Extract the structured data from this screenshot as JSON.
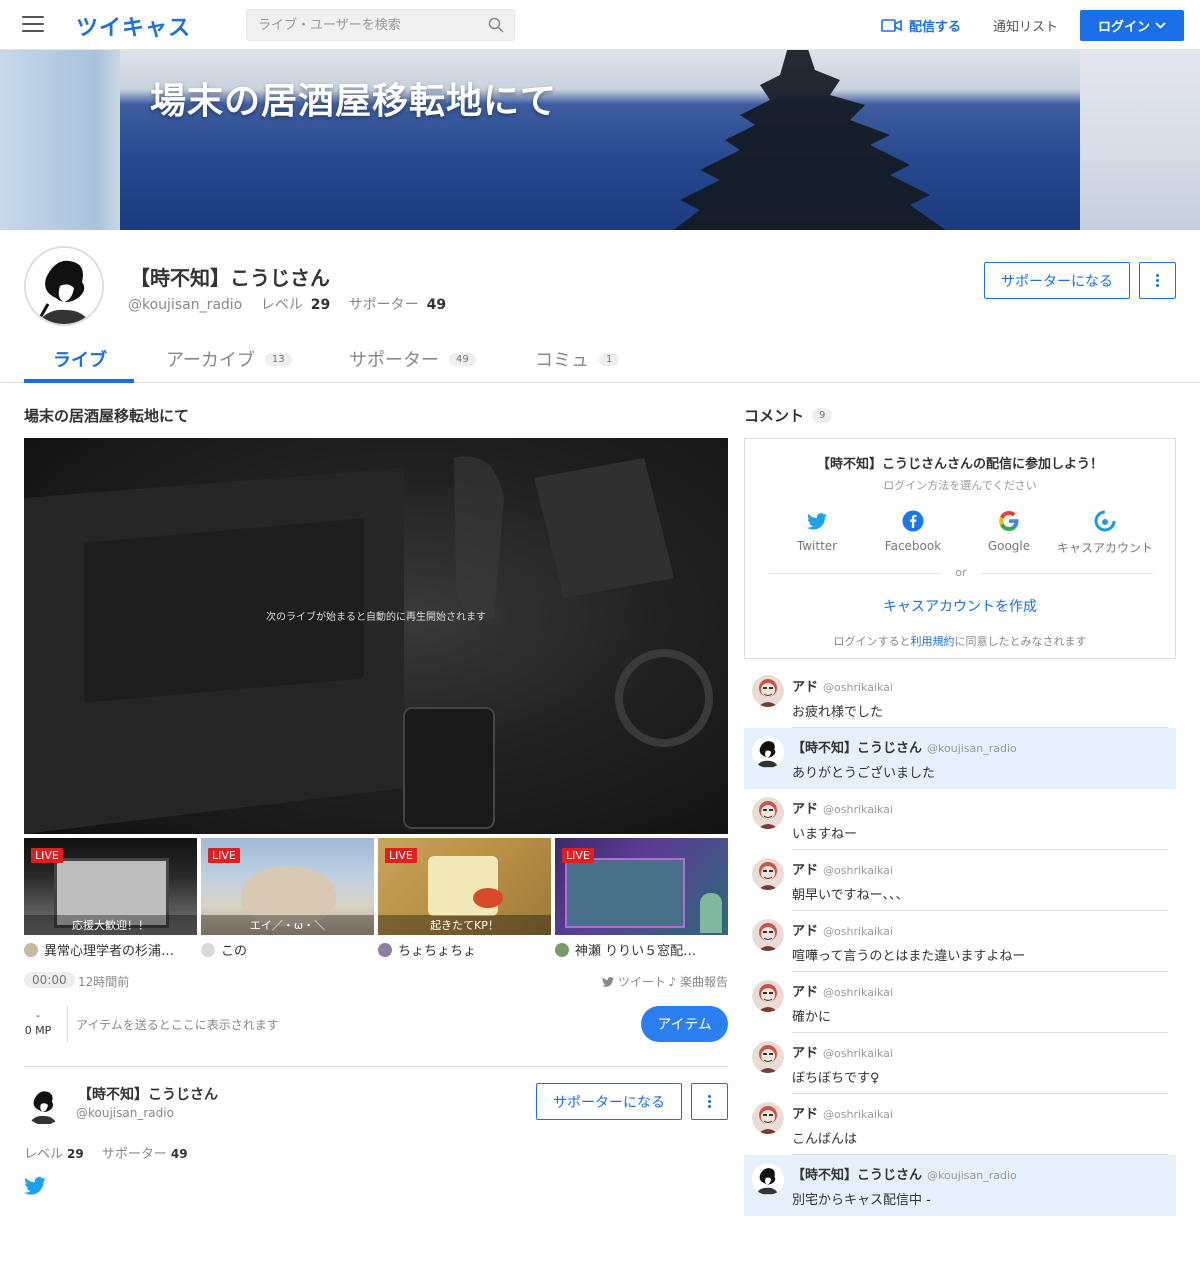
{
  "header": {
    "logo": "ツイキャス",
    "search_placeholder": "ライブ・ユーザーを検索",
    "broadcast_label": "配信する",
    "notifications_label": "通知リスト",
    "login_label": "ログイン"
  },
  "banner": {
    "title": "場末の居酒屋移転地にて"
  },
  "profile": {
    "name": "【時不知】こうじさん",
    "handle": "@koujisan_radio",
    "level_label": "レベル",
    "level": "29",
    "supporters_label": "サポーター",
    "supporters": "49",
    "supporter_button": "サポーターになる"
  },
  "tabs": [
    {
      "label": "ライブ",
      "count": ""
    },
    {
      "label": "アーカイブ",
      "count": "13"
    },
    {
      "label": "サポーター",
      "count": "49"
    },
    {
      "label": "コミュ",
      "count": "1"
    }
  ],
  "live": {
    "title": "場末の居酒屋移転地にて",
    "player_message": "次のライブが始まると自動的に再生開始されます",
    "time": "00:00",
    "ago": "12時間前",
    "tweet_label": "ツイート",
    "song_label": "楽曲報告",
    "mp_dash": "-",
    "mp_value": "0 MP",
    "item_message": "アイテムを送るとここに表示されます",
    "item_button": "アイテム"
  },
  "thumbnails": [
    {
      "badge": "LIVE",
      "caption": "応援大歓迎！！",
      "name": "異常心理学者の杉浦…"
    },
    {
      "badge": "LIVE",
      "caption": "エイ／・ω・＼",
      "name": "この"
    },
    {
      "badge": "LIVE",
      "caption": "起きたてKP！",
      "name": "ちょちょちょ"
    },
    {
      "badge": "LIVE",
      "caption": "",
      "name": "神瀬 りりい５窓配…"
    }
  ],
  "bio": {
    "name": "【時不知】こうじさん",
    "handle": "@koujisan_radio",
    "supporter_button": "サポーターになる",
    "level_label": "レベル",
    "level": "29",
    "supporters_label": "サポーター",
    "supporters": "49"
  },
  "comments_panel": {
    "title": "コメント",
    "count": "9",
    "login_title": "【時不知】こうじさんさんの配信に参加しよう！",
    "login_sub": "ログイン方法を選んでください",
    "providers": [
      "Twitter",
      "Facebook",
      "Google",
      "キャスアカウント"
    ],
    "or": "or",
    "create_account": "キャスアカウントを作成",
    "terms_prefix": "ログインすると",
    "terms_link": "利用規約",
    "terms_suffix": "に同意したとみなされます"
  },
  "comments": [
    {
      "name": "アド",
      "handle": "@oshrikaikai",
      "text": "お疲れ様でした",
      "own": false
    },
    {
      "name": "【時不知】こうじさん",
      "handle": "@koujisan_radio",
      "text": "ありがとうございました",
      "own": true
    },
    {
      "name": "アド",
      "handle": "@oshrikaikai",
      "text": "いますねー",
      "own": false
    },
    {
      "name": "アド",
      "handle": "@oshrikaikai",
      "text": "朝早いですねー、、、",
      "own": false
    },
    {
      "name": "アド",
      "handle": "@oshrikaikai",
      "text": "喧嘩って言うのとはまた違いますよねー",
      "own": false
    },
    {
      "name": "アド",
      "handle": "@oshrikaikai",
      "text": "確かに",
      "own": false
    },
    {
      "name": "アド",
      "handle": "@oshrikaikai",
      "text": "ぼちぼちです♀",
      "own": false
    },
    {
      "name": "アド",
      "handle": "@oshrikaikai",
      "text": "こんばんは",
      "own": false
    },
    {
      "name": "【時不知】こうじさん",
      "handle": "@koujisan_radio",
      "text": "別宅からキャス配信中 -",
      "own": true
    }
  ],
  "colors": {
    "accent": "#1a6fe8",
    "live_badge": "#e02020",
    "own_comment_bg": "#e6f0fc"
  }
}
